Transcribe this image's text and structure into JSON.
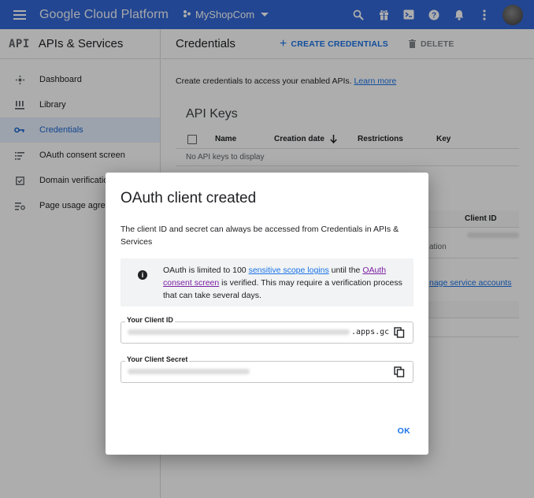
{
  "topbar": {
    "brand": "Google Cloud Platform",
    "project": "MyShopCom",
    "icons": [
      "search-icon",
      "gift-icon",
      "terminal-icon",
      "help-icon",
      "bell-icon",
      "more-vert-icon"
    ]
  },
  "sidebar": {
    "logo": "API",
    "title": "APIs & Services",
    "items": [
      {
        "label": "Dashboard",
        "icon": "dashboard-icon"
      },
      {
        "label": "Library",
        "icon": "library-icon"
      },
      {
        "label": "Credentials",
        "icon": "key-icon"
      },
      {
        "label": "OAuth consent screen",
        "icon": "consent-icon"
      },
      {
        "label": "Domain verification",
        "icon": "domain-icon"
      },
      {
        "label": "Page usage agreements",
        "icon": "settings-list-icon"
      }
    ]
  },
  "main": {
    "title": "Credentials",
    "create_label": "CREATE CREDENTIALS",
    "delete_label": "DELETE",
    "intro_text": "Create credentials to access your enabled APIs.",
    "learn_more": "Learn more",
    "api_keys": {
      "title": "API Keys",
      "columns": [
        "Name",
        "Creation date",
        "Restrictions",
        "Key"
      ],
      "empty": "No API keys to display"
    },
    "oauth_peek": {
      "column": "Client ID",
      "cell_fragment": "ation"
    },
    "service_link": "nage service accounts"
  },
  "dialog": {
    "title": "OAuth client created",
    "text": "The client ID and secret can always be accessed from Credentials in APIs & Services",
    "info": {
      "pre": "OAuth is limited to 100 ",
      "link1": "sensitive scope logins",
      "mid": " until the ",
      "link2": "OAuth consent screen",
      "post": " is verified. This may require a verification process that can take several days."
    },
    "client_id": {
      "label": "Your Client ID",
      "suffix": ".apps.gc"
    },
    "client_secret": {
      "label": "Your Client Secret"
    },
    "ok_label": "OK"
  }
}
